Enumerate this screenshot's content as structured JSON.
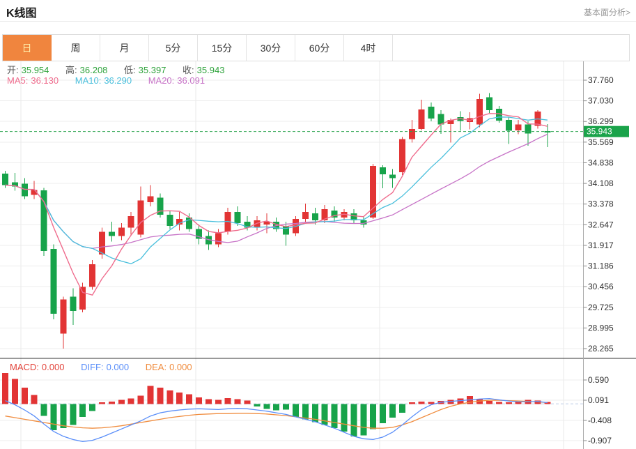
{
  "header": {
    "title": "K线图",
    "link": "基本面分析>"
  },
  "tabs": {
    "items": [
      "日",
      "周",
      "月",
      "5分",
      "15分",
      "30分",
      "60分",
      "4时"
    ],
    "selected": "日",
    "selected_index": 0
  },
  "ohlc": {
    "open_label": "开:",
    "open": "35.954",
    "high_label": "高:",
    "high": "36.208",
    "low_label": "低:",
    "low": "35.397",
    "close_label": "收:",
    "close": "35.943"
  },
  "ma_legend": {
    "ma5_label": "MA5:",
    "ma5": "36.130",
    "ma10_label": "MA10:",
    "ma10": "36.290",
    "ma20_label": "MA20:",
    "ma20": "36.091"
  },
  "macd_legend": {
    "macd_label": "MACD:",
    "macd": "0.000",
    "diff_label": "DIFF:",
    "diff": "0.000",
    "dea_label": "DEA:",
    "dea": "0.000"
  },
  "colors": {
    "bull_red": "#e23434",
    "bear_green": "#17a34a",
    "ma5": "#ef6c8d",
    "ma10": "#49bfdc",
    "ma20": "#c773c7",
    "diff_blue": "#5b8ff9",
    "dea_orange": "#f08c3e",
    "tab_active_bg": "#f0853e",
    "tab_active_text": "#ffedaa",
    "price_badge_bg": "#1aa34a",
    "price_badge_text": "#ffffff",
    "current_price_line": "#2da44e",
    "grid": "#ededed",
    "vgrid": "#e8e8e8",
    "axis": "#aaaaaa",
    "tick_text": "#333333",
    "panel_divider": "#333333",
    "macd_zero_dash": "#b9c9e6"
  },
  "chart_data": [
    {
      "type": "candlestick",
      "panel": "price",
      "title": "K线图 daily candles",
      "y_axis_labels": [
        "37.760",
        "37.030",
        "36.299",
        "35.569",
        "34.838",
        "34.108",
        "33.378",
        "32.647",
        "31.917",
        "31.186",
        "30.456",
        "29.725",
        "28.995",
        "28.265"
      ],
      "ylim": [
        28.265,
        37.76
      ],
      "grid": true,
      "legend": [
        "MA5",
        "MA10",
        "MA20"
      ],
      "ma_periods": [
        5,
        10,
        20
      ],
      "current_price": 35.943,
      "current_price_label": "35.943",
      "candles_ohlc": [
        [
          34.45,
          34.55,
          33.95,
          34.05
        ],
        [
          34.15,
          34.48,
          33.85,
          34.0
        ],
        [
          34.1,
          34.3,
          33.55,
          33.65
        ],
        [
          33.7,
          34.2,
          33.55,
          33.88
        ],
        [
          33.86,
          33.95,
          31.55,
          31.72
        ],
        [
          31.79,
          31.95,
          29.3,
          29.5
        ],
        [
          28.8,
          30.1,
          28.265,
          30.0
        ],
        [
          30.1,
          30.4,
          29.1,
          29.6
        ],
        [
          29.65,
          30.6,
          29.55,
          30.45
        ],
        [
          30.45,
          31.4,
          30.35,
          31.25
        ],
        [
          31.6,
          32.55,
          31.45,
          32.4
        ],
        [
          32.4,
          32.75,
          32.05,
          32.25
        ],
        [
          32.25,
          32.7,
          32.1,
          32.55
        ],
        [
          32.55,
          33.1,
          32.3,
          32.95
        ],
        [
          32.3,
          34.0,
          32.2,
          33.5
        ],
        [
          33.45,
          34.05,
          33.3,
          33.65
        ],
        [
          33.6,
          33.75,
          32.9,
          33.0
        ],
        [
          33.0,
          33.15,
          32.5,
          32.6
        ],
        [
          32.65,
          33.1,
          32.45,
          32.85
        ],
        [
          32.9,
          33.05,
          32.4,
          32.5
        ],
        [
          32.5,
          32.65,
          31.95,
          32.15
        ],
        [
          32.25,
          32.45,
          31.75,
          31.95
        ],
        [
          31.95,
          32.5,
          31.85,
          32.35
        ],
        [
          32.4,
          33.25,
          32.3,
          33.1
        ],
        [
          33.1,
          33.3,
          32.6,
          32.7
        ],
        [
          32.75,
          32.95,
          32.45,
          32.55
        ],
        [
          32.55,
          32.95,
          32.45,
          32.8
        ],
        [
          32.65,
          33.05,
          32.35,
          32.75
        ],
        [
          32.75,
          32.9,
          32.4,
          32.5
        ],
        [
          32.6,
          32.75,
          31.9,
          32.3
        ],
        [
          32.35,
          32.95,
          32.25,
          32.85
        ],
        [
          32.85,
          33.4,
          32.75,
          33.1
        ],
        [
          33.05,
          33.25,
          32.65,
          32.8
        ],
        [
          32.8,
          33.35,
          32.7,
          33.2
        ],
        [
          33.15,
          33.3,
          32.75,
          32.9
        ],
        [
          32.9,
          33.2,
          32.8,
          33.1
        ],
        [
          33.05,
          33.2,
          32.7,
          32.8
        ],
        [
          32.8,
          32.95,
          32.55,
          32.65
        ],
        [
          32.9,
          34.8,
          32.85,
          34.73
        ],
        [
          34.68,
          34.75,
          33.94,
          34.43
        ],
        [
          34.42,
          34.62,
          33.95,
          34.3
        ],
        [
          34.5,
          35.75,
          34.4,
          35.67
        ],
        [
          35.67,
          36.36,
          35.55,
          36.03
        ],
        [
          36.03,
          37.07,
          35.98,
          36.72
        ],
        [
          36.82,
          36.97,
          36.3,
          36.4
        ],
        [
          36.57,
          36.7,
          35.86,
          36.2
        ],
        [
          36.21,
          36.4,
          35.55,
          36.36
        ],
        [
          36.45,
          36.66,
          35.97,
          36.32
        ],
        [
          36.28,
          36.62,
          36.02,
          36.42
        ],
        [
          36.2,
          37.28,
          36.1,
          37.1
        ],
        [
          37.15,
          37.3,
          36.6,
          36.7
        ],
        [
          36.75,
          36.85,
          36.25,
          36.33
        ],
        [
          36.36,
          36.45,
          35.5,
          35.97
        ],
        [
          35.99,
          36.35,
          35.85,
          36.2
        ],
        [
          36.2,
          36.3,
          35.44,
          35.87
        ],
        [
          36.15,
          36.7,
          36.05,
          36.65
        ],
        [
          35.954,
          36.208,
          35.397,
          35.943
        ]
      ]
    },
    {
      "type": "bar",
      "panel": "macd",
      "title": "MACD histogram with DIFF / DEA lines",
      "y_axis_labels": [
        "0.590",
        "0.091",
        "-0.408",
        "-0.907"
      ],
      "ylim": [
        -0.907,
        0.59
      ],
      "grid": true,
      "values": [
        0.76,
        0.62,
        0.4,
        0.22,
        -0.3,
        -0.65,
        -0.6,
        -0.52,
        -0.32,
        -0.18,
        0.04,
        0.06,
        0.1,
        0.13,
        0.2,
        0.44,
        0.4,
        0.33,
        0.28,
        0.24,
        0.16,
        0.12,
        0.1,
        0.14,
        0.12,
        0.08,
        -0.06,
        -0.12,
        -0.16,
        -0.14,
        -0.32,
        -0.38,
        -0.45,
        -0.52,
        -0.6,
        -0.68,
        -0.8,
        -0.78,
        -0.62,
        -0.48,
        -0.34,
        -0.22,
        0.04,
        0.06,
        0.05,
        0.07,
        0.1,
        0.13,
        0.19,
        0.12,
        0.07,
        0.05,
        0.04,
        0.06,
        0.1,
        0.08,
        0.05
      ],
      "series": [
        {
          "name": "DIFF",
          "values": [
            0.08,
            -0.02,
            -0.15,
            -0.3,
            -0.5,
            -0.68,
            -0.8,
            -0.88,
            -0.93,
            -0.9,
            -0.82,
            -0.72,
            -0.62,
            -0.52,
            -0.42,
            -0.3,
            -0.22,
            -0.18,
            -0.15,
            -0.13,
            -0.12,
            -0.13,
            -0.14,
            -0.12,
            -0.11,
            -0.12,
            -0.15,
            -0.18,
            -0.22,
            -0.26,
            -0.32,
            -0.38,
            -0.44,
            -0.52,
            -0.6,
            -0.7,
            -0.8,
            -0.86,
            -0.88,
            -0.82,
            -0.7,
            -0.52,
            -0.32,
            -0.14,
            -0.02,
            0.04,
            0.06,
            0.08,
            0.1,
            0.12,
            0.13,
            0.1,
            0.07,
            0.05,
            0.05,
            0.06,
            0.03
          ]
        },
        {
          "name": "DEA",
          "values": [
            -0.3,
            -0.34,
            -0.38,
            -0.42,
            -0.46,
            -0.5,
            -0.54,
            -0.57,
            -0.59,
            -0.6,
            -0.59,
            -0.57,
            -0.54,
            -0.5,
            -0.46,
            -0.42,
            -0.38,
            -0.34,
            -0.31,
            -0.28,
            -0.26,
            -0.25,
            -0.24,
            -0.24,
            -0.23,
            -0.23,
            -0.24,
            -0.25,
            -0.27,
            -0.29,
            -0.32,
            -0.35,
            -0.38,
            -0.42,
            -0.46,
            -0.5,
            -0.54,
            -0.58,
            -0.6,
            -0.6,
            -0.58,
            -0.52,
            -0.44,
            -0.34,
            -0.24,
            -0.14,
            -0.06,
            0.0,
            0.04,
            0.07,
            0.09,
            0.09,
            0.08,
            0.07,
            0.06,
            0.05,
            0.03
          ]
        }
      ]
    }
  ]
}
